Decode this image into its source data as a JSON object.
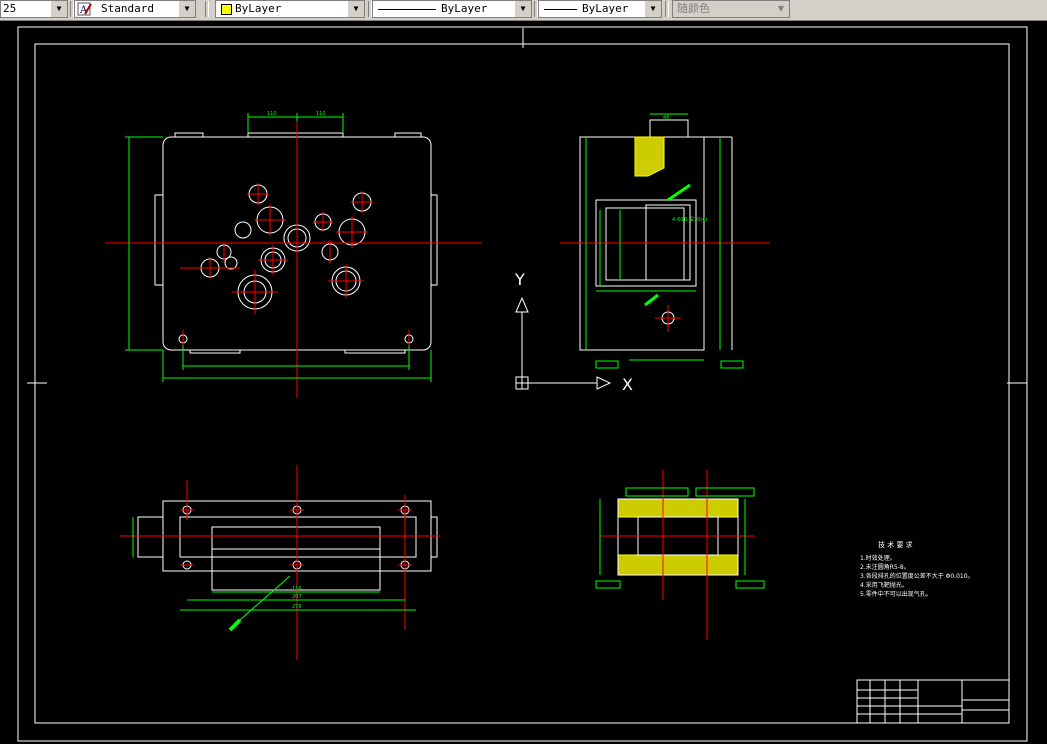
{
  "toolbar": {
    "scale_value": "25",
    "textstyle": {
      "icon": "text-style-icon",
      "value": "Standard"
    },
    "layer_color": {
      "value": "ByLayer",
      "swatch_color": "#ffff00"
    },
    "linetype": {
      "value": "ByLayer"
    },
    "lineweight": {
      "value": "ByLayer"
    },
    "plotstyle": {
      "value": "随颜色"
    }
  },
  "drawing": {
    "background": "#000000",
    "colors": {
      "geometry": "#ffffff",
      "center_lines": "#ff0000",
      "dimensions": "#00ff00"
    },
    "ucs": {
      "y_label": "Y",
      "x_label": "X"
    },
    "tech_requirements": {
      "title": "技 术 要 求",
      "items": [
        "1.时效处理。",
        "2.未注圆角R5-8。",
        "3.各段排孔的位置度公差不大于 Φ0.010。",
        "4.采用飞靶抛光。",
        "5.零件中不可以出现气孔。"
      ]
    },
    "dimensions": {
      "top_left_110a": "110",
      "top_left_110b": "110",
      "right_top_48": "48",
      "note_4x": "4-Φ10 深10(4)",
      "bottom_116": "116",
      "bottom_207": "207",
      "bottom_276": "276"
    }
  }
}
